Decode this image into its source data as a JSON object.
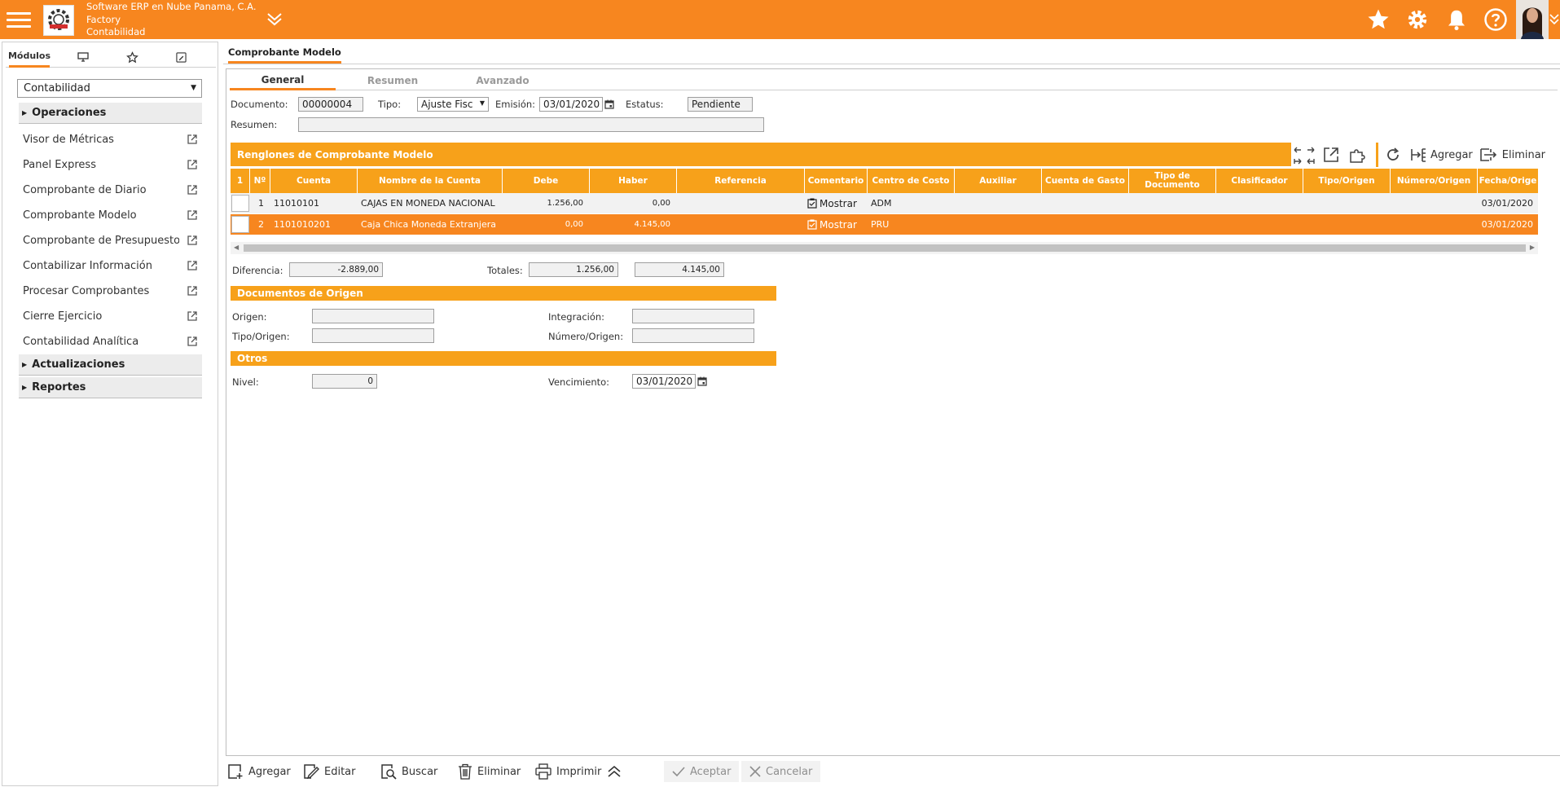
{
  "header": {
    "company": "Software ERP en Nube Panama, C.A.",
    "branch": "Factory",
    "module": "Contabilidad"
  },
  "sidebar": {
    "tab_modulos": "Módulos",
    "module_select": "Contabilidad",
    "groups": {
      "operaciones": "Operaciones",
      "actualizaciones": "Actualizaciones",
      "reportes": "Reportes"
    },
    "items": [
      "Visor de Métricas",
      "Panel Express",
      "Comprobante de Diario",
      "Comprobante Modelo",
      "Comprobante de Presupuesto",
      "Contabilizar Información",
      "Procesar Comprobantes",
      "Cierre Ejercicio",
      "Contabilidad Analítica"
    ]
  },
  "main": {
    "title": "Comprobante Modelo",
    "tabs": [
      "General",
      "Resumen",
      "Avanzado"
    ]
  },
  "form": {
    "documento_label": "Documento:",
    "documento": "00000004",
    "tipo_label": "Tipo:",
    "tipo": "Ajuste Fisc",
    "emision_label": "Emisión:",
    "emision": "03/01/2020",
    "estatus_label": "Estatus:",
    "estatus": "Pendiente",
    "resumen_label": "Resumen:",
    "resumen": ""
  },
  "grid": {
    "title": "Renglones de Comprobante Modelo",
    "agregar": "Agregar",
    "eliminar": "Eliminar",
    "columns": [
      "1",
      "Nº",
      "Cuenta",
      "Nombre de la Cuenta",
      "Debe",
      "Haber",
      "Referencia",
      "Comentario",
      "Centro de Costo",
      "Auxiliar",
      "Cuenta de Gasto",
      "Tipo de Documento",
      "Clasificador",
      "Tipo/Origen",
      "Número/Origen",
      "Fecha/Orige"
    ],
    "rows": [
      {
        "n": "1",
        "cuenta": "11010101",
        "nombre": "CAJAS EN MONEDA NACIONAL",
        "debe": "1.256,00",
        "haber": "0,00",
        "comentario": "Mostrar",
        "centro": "ADM",
        "fecha": "03/01/2020"
      },
      {
        "n": "2",
        "cuenta": "1101010201",
        "nombre": "Caja Chica Moneda Extranjera",
        "debe": "0,00",
        "haber": "4.145,00",
        "comentario": "Mostrar",
        "centro": "PRU",
        "fecha": "03/01/2020"
      }
    ]
  },
  "totals": {
    "diferencia_label": "Diferencia:",
    "diferencia": "-2.889,00",
    "totales_label": "Totales:",
    "total_debe": "1.256,00",
    "total_haber": "4.145,00"
  },
  "origen": {
    "title": "Documentos de Origen",
    "origen_label": "Origen:",
    "integracion_label": "Integración:",
    "tipo_origen_label": "Tipo/Origen:",
    "numero_origen_label": "Número/Origen:"
  },
  "otros": {
    "title": "Otros",
    "nivel_label": "Nivel:",
    "nivel": "0",
    "vencimiento_label": "Vencimiento:",
    "vencimiento": "03/01/2020"
  },
  "actions": {
    "agregar": "Agregar",
    "editar": "Editar",
    "buscar": "Buscar",
    "eliminar": "Eliminar",
    "imprimir": "Imprimir",
    "aceptar": "Aceptar",
    "cancelar": "Cancelar"
  },
  "colors": {
    "brand": "#f7861f",
    "section": "#f7a11a"
  }
}
